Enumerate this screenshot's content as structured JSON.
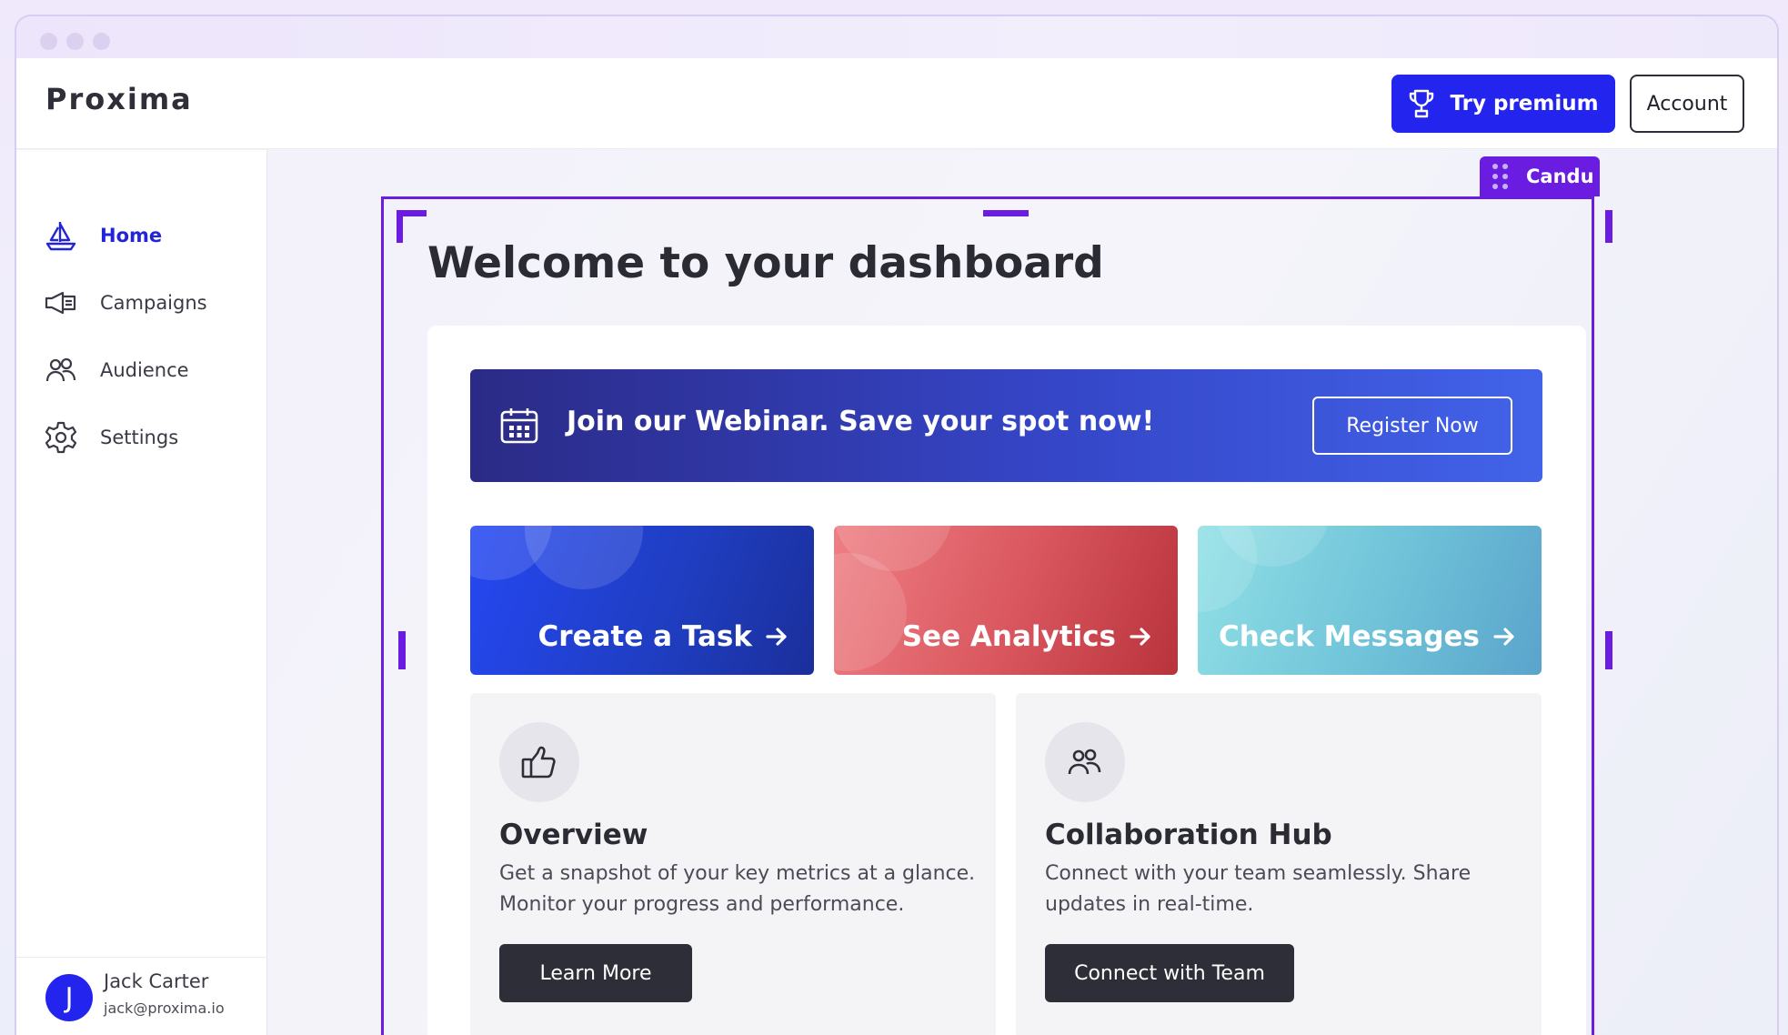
{
  "app": {
    "logo_text": "Proxima"
  },
  "header": {
    "premium_label": "Try premium",
    "account_label": "Account"
  },
  "sidebar": {
    "items": [
      {
        "label": "Home",
        "icon": "sailboat-icon",
        "active": true
      },
      {
        "label": "Campaigns",
        "icon": "megaphone-icon"
      },
      {
        "label": "Audience",
        "icon": "people-icon"
      },
      {
        "label": "Settings",
        "icon": "gear-icon"
      }
    ]
  },
  "user": {
    "initial": "J",
    "name": "Jack Carter",
    "email": "jack@proxima.io"
  },
  "editor": {
    "badge_label": "Candu",
    "accent": "#6a1de0"
  },
  "dashboard": {
    "title": "Welcome to your dashboard",
    "banner": {
      "text": "Join our Webinar. Save your spot now!",
      "button": "Register Now",
      "icon": "calendar-icon"
    },
    "tiles": [
      {
        "label": "Create a Task",
        "color": "#2548f3"
      },
      {
        "label": "See Analytics",
        "color": "#d9555d"
      },
      {
        "label": "Check Messages",
        "color": "#6fc2d8"
      }
    ],
    "cards": [
      {
        "icon": "thumbs-up-icon",
        "title": "Overview",
        "description": "Get a snapshot of your key metrics at a glance. Monitor your progress and performance.",
        "button": "Learn More"
      },
      {
        "icon": "people-icon",
        "title": "Collaboration Hub",
        "description": "Connect with your team seamlessly. Share updates in real-time.",
        "button": "Connect with Team"
      }
    ]
  },
  "colors": {
    "primary": "#2424ef",
    "dark_button": "#2e2e38"
  }
}
